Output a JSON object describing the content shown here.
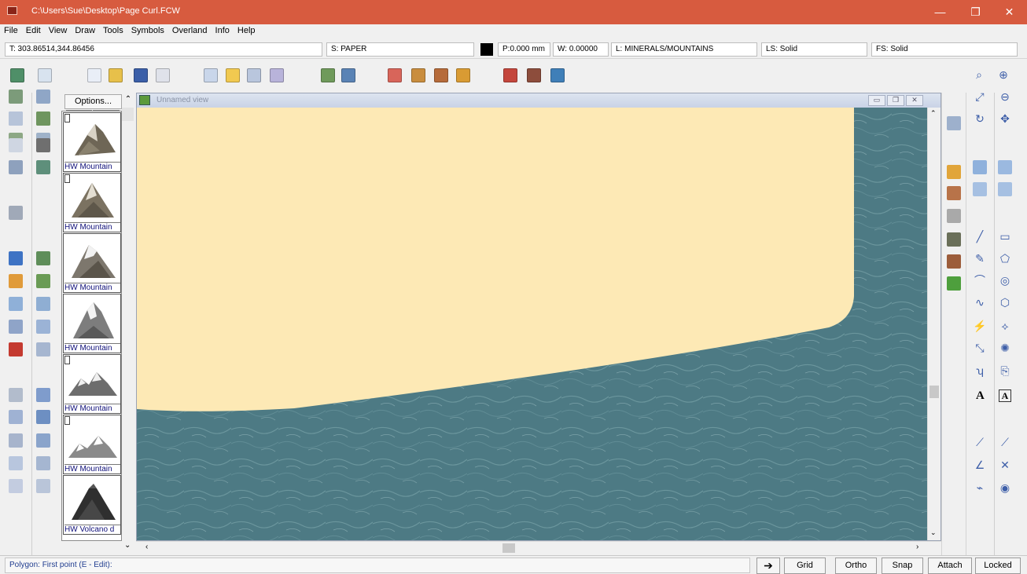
{
  "window": {
    "title": "C:\\Users\\Sue\\Desktop\\Page Curl.FCW",
    "controls": {
      "minimize": "—",
      "restore": "❐",
      "close": "✕"
    }
  },
  "menu": [
    "File",
    "Edit",
    "View",
    "Draw",
    "Tools",
    "Symbols",
    "Overland",
    "Info",
    "Help"
  ],
  "status_fields": {
    "coords": "T: 303.86514,344.86456",
    "sheet": "S: PAPER",
    "pen": "P:0.000 mm",
    "width": "W: 0.00000",
    "layer": "L: MINERALS/MOUNTAINS",
    "line_style": "LS: Solid",
    "fill_style": "FS: Solid"
  },
  "symbol_panel": {
    "options_label": "Options...",
    "items": [
      "HW Mountain",
      "HW Mountain",
      "HW Mountain",
      "HW Mountain",
      "HW Mountain",
      "HW Mountain",
      "HW Volcano d"
    ]
  },
  "view": {
    "caption": "Unnamed view"
  },
  "statusbar": {
    "prompt": "Polygon: First point (E - Edit):",
    "buttons": [
      "Grid",
      "Ortho",
      "Snap",
      "Attach",
      "Locked"
    ]
  },
  "colors": {
    "titlebar": "#d75b3f",
    "paper": "#fde9b5",
    "water": "#4d7a84"
  },
  "icons": {
    "right_text_tool_a": "A",
    "right_text_tool_b": "A"
  }
}
